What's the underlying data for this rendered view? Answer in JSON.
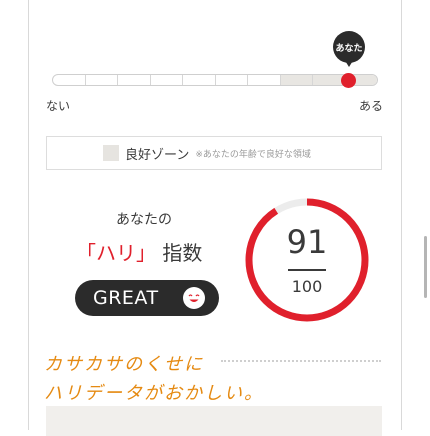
{
  "slider": {
    "marker_label": "あなた",
    "low_label": "ない",
    "high_label": "ある",
    "segment_count": 10,
    "good_zone_segments": [
      8,
      9,
      10
    ],
    "user_position_fraction": 0.91,
    "accent_color": "#e0202c"
  },
  "legend": {
    "title": "良好ゾーン",
    "note": "※あなたの年齢で良好な領域"
  },
  "score": {
    "label": "あなたの",
    "title_highlight": "「ハリ」",
    "title_rest": " 指数",
    "rating": "GREAT",
    "rating_icon": "smile-face-icon",
    "value": "91",
    "max": "100",
    "fraction": 0.91,
    "ring_color": "#e0202c"
  },
  "comment": {
    "line1": "カサカサのくせに",
    "line2": "ハリデータがおかしい。",
    "color": "#e58a12"
  }
}
